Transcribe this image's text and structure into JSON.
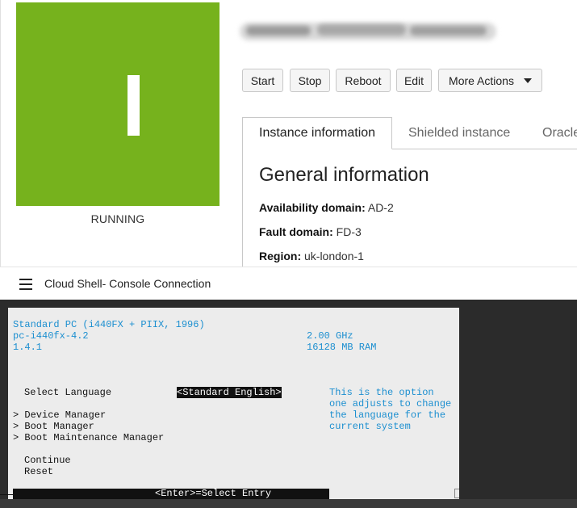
{
  "instance": {
    "icon_letter": "I",
    "state": "RUNNING",
    "tile_color": "#76b21d",
    "name_redacted": true
  },
  "actions": {
    "start": "Start",
    "stop": "Stop",
    "reboot": "Reboot",
    "edit": "Edit",
    "more": "More Actions"
  },
  "tabs": [
    "Instance information",
    "Shielded instance",
    "Oracle"
  ],
  "general": {
    "title": "General information",
    "availability_label": "Availability domain:",
    "availability_value": "AD-2",
    "fault_label": "Fault domain:",
    "fault_value": "FD-3",
    "region_label": "Region:",
    "region_value": "uk-london-1"
  },
  "shell": {
    "menu_icon": "hamburger-icon",
    "title": "Cloud Shell- Console Connection"
  },
  "bios": {
    "line1": "Standard PC (i440FX + PIIX, 1996)",
    "line2": "pc-i440fx-4.2",
    "line3": "1.4.1",
    "cpu": "2.00 GHz",
    "ram": "16128 MB RAM",
    "select_language": "Select Language",
    "language_value": "<Standard English>",
    "help_text": "This is the option\none adjusts to change\nthe language for the\ncurrent system",
    "device_manager": "> Device Manager",
    "boot_manager": "> Boot Manager",
    "boot_maintenance": "> Boot Maintenance Manager",
    "continue": "Continue",
    "reset": "Reset",
    "status": "<Enter>=Select Entry"
  }
}
